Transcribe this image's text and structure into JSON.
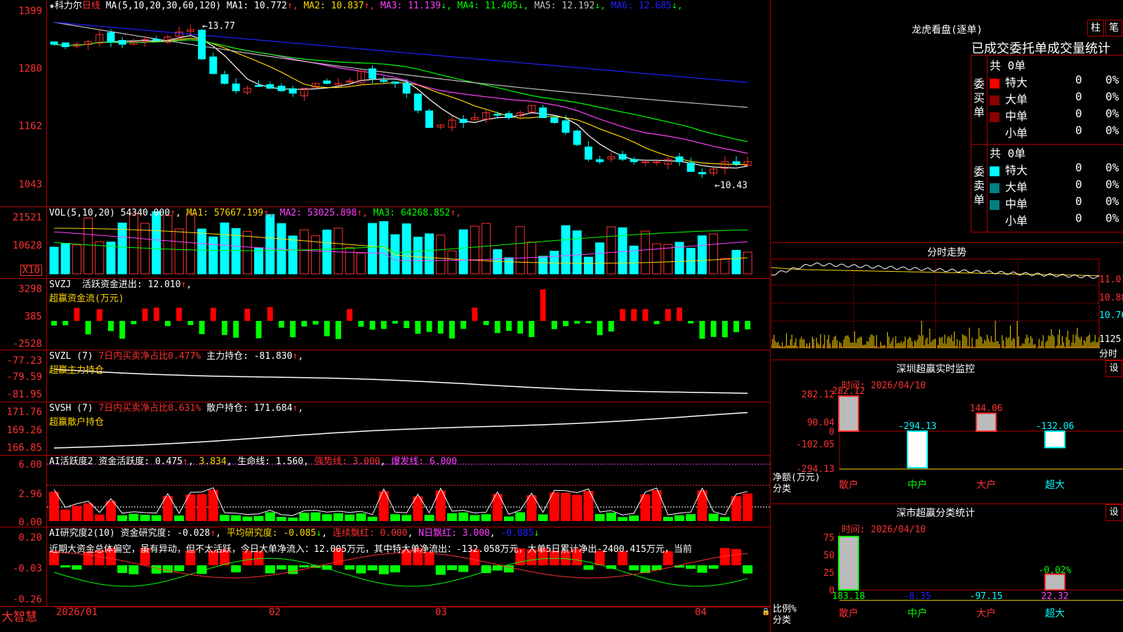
{
  "stock": {
    "name": "科力尔",
    "period": "日线",
    "ma_label": "MA(5,10,20,30,60,120)",
    "ma": [
      {
        "name": "MA1:",
        "value": "10.772",
        "dir": "↑",
        "color": "#ffffff"
      },
      {
        "name": "MA2:",
        "value": "10.837",
        "dir": "↑",
        "color": "#ffd700"
      },
      {
        "name": "MA3:",
        "value": "11.139",
        "dir": "↓",
        "color": "#ff40ff"
      },
      {
        "name": "MA4:",
        "value": "11.405",
        "dir": "↓",
        "color": "#00ff00"
      },
      {
        "name": "MA5:",
        "value": "12.192",
        "dir": "↓",
        "color": "#c0c0c0"
      },
      {
        "name": "MA6:",
        "value": "12.685",
        "dir": "↓",
        "color": "#2020ff"
      }
    ],
    "price_ticks": [
      "1399",
      "1280",
      "1162",
      "1043"
    ],
    "high_marker": "13.77",
    "low_marker": "10.43"
  },
  "vol": {
    "label": "VOL(5,10,20)",
    "value": "54340.000",
    "ma": [
      {
        "name": "MA1:",
        "value": "57667.199",
        "color": "#ffd700"
      },
      {
        "name": "MA2:",
        "value": "53025.898",
        "color": "#ff40ff"
      },
      {
        "name": "MA3:",
        "value": "64268.852",
        "color": "#00ff00"
      }
    ],
    "ticks": [
      "21521",
      "10628"
    ],
    "unit": "X10"
  },
  "svzj": {
    "label": "SVZJ",
    "text": "活跃资金进出: 12.010",
    "sub": "超赢资金流(万元)",
    "ticks": [
      "3298",
      "385",
      "-2528"
    ]
  },
  "svzl": {
    "label": "SVZL (7)",
    "ratio": "7日内买卖净占比0.477%",
    "text": "主力持仓: -81.830",
    "sub": "超赢主力持仓",
    "ticks": [
      "-77.23",
      "-79.59",
      "-81.95"
    ]
  },
  "svsh": {
    "label": "SVSH (7)",
    "ratio": "7日内买卖净占比0.631%",
    "text": "散户持仓: 171.684",
    "sub": "超赢散户持仓",
    "ticks": [
      "171.76",
      "169.26",
      "166.85"
    ]
  },
  "ai1": {
    "label": "AI活跃度2",
    "a": "资金活跃度: 0.475",
    "b": "3.834",
    "c": "生命线: 1.560",
    "d": "强势线: 3.000",
    "e": "爆发线: 6.000",
    "ticks": [
      "6.00",
      "2.96",
      "0.00"
    ]
  },
  "ai2": {
    "label": "AI研究度2(10)",
    "a": "资金研究度: -0.028",
    "b": "平均研究度: -0.085",
    "c": "连续飘红: 0.000",
    "d": "N日飘红: 3.000",
    "e": "-0.085",
    "comment": "近期大资金总体偏空，虽有异动，但不太活跃，今日大单净流入：12.005万元，其中特大单净流出：-132.058万元，大单5日累计净出-2400.415万元，当前",
    "ticks": [
      "0.20",
      "-0.03",
      "-0.26"
    ]
  },
  "dates": [
    "2026/01",
    "02",
    "03",
    "04"
  ],
  "brand": "大智慧",
  "dragon": {
    "title": "龙虎看盘(逐单)",
    "btn1": "柱",
    "btn2": "笔",
    "header": "已成交委托单成交量统计",
    "buy_label": "委买单",
    "sell_label": "委卖单",
    "buy_total": "共 0单",
    "sell_total": "共 0单",
    "rows": [
      {
        "name": "特大",
        "count": "0",
        "pct": "0%"
      },
      {
        "name": "大单",
        "count": "0",
        "pct": "0%"
      },
      {
        "name": "中单",
        "count": "0",
        "pct": "0%"
      },
      {
        "name": "小单",
        "count": "0",
        "pct": "0%"
      }
    ],
    "buy_colors": [
      "#ff0000",
      "#8b0000",
      "#8b0000",
      "#000000"
    ],
    "sell_colors": [
      "#00ffff",
      "#008080",
      "#008080",
      "#000000"
    ]
  },
  "intraday": {
    "title": "分时走势",
    "ticks": [
      "11.01",
      "10.88",
      "10.76"
    ],
    "vol_tick": "1125",
    "vol_unit": "分时"
  },
  "monitor": {
    "title": "深圳超赢实时监控",
    "btn": "设",
    "time": "时间: 2026/04/10",
    "ticks": [
      "282.12",
      "90.04",
      "0",
      "-102.05",
      "-294.13"
    ],
    "y_label1": "净额(万元)",
    "y_label2": "分类",
    "categories": [
      "散户",
      "中户",
      "大户",
      "超大"
    ],
    "values": [
      282.12,
      -294.13,
      144.06,
      -132.06
    ],
    "value_labels": [
      "282.12",
      "-294.13",
      "144.06",
      "-132.06"
    ]
  },
  "classify": {
    "title": "深市超赢分类统计",
    "btn": "设",
    "time": "时间: 2026/04/10",
    "ticks": [
      "75",
      "50",
      "25",
      "0"
    ],
    "y_label1": "比例%",
    "y_label2": "分类",
    "categories": [
      "散户",
      "中户",
      "大户",
      "超大"
    ],
    "values": [
      183.18,
      -8.35,
      -97.15,
      22.32
    ],
    "value_labels": [
      "183.18",
      "-8.35",
      "-97.15",
      "22.32"
    ],
    "annot": "-0.02%"
  }
}
